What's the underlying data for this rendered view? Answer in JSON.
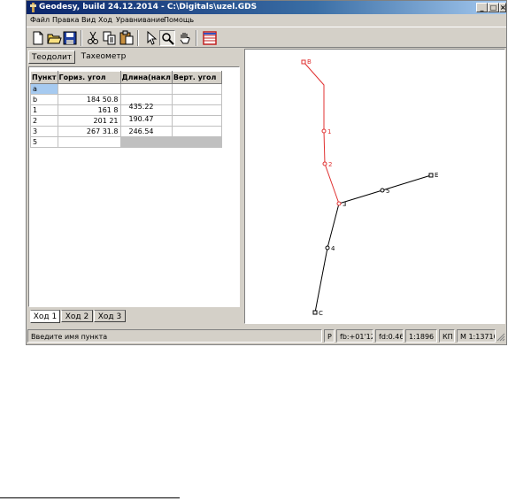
{
  "window": {
    "title": "Geodesy, build 24.12.2014 - C:\\Digitals\\uzel.GDS",
    "controls": [
      "_",
      "□",
      "×"
    ]
  },
  "menu": [
    "Файл",
    "Правка",
    "Вид",
    "Ход",
    "Уравнивание",
    "Помощь"
  ],
  "toolbar": {
    "icons": [
      "new-file-icon",
      "open-folder-icon",
      "save-icon",
      "cut-icon",
      "copy-icon",
      "paste-icon",
      "pointer-icon",
      "zoom-icon",
      "hand-icon",
      "table-icon"
    ]
  },
  "tabs": [
    "Теодолит",
    "Тахеометр"
  ],
  "grid": {
    "columns": [
      "Пункт",
      "Гориз. угол",
      "Длина(накл",
      "Верт. угол"
    ],
    "rows": [
      {
        "point": "a",
        "angle": ""
      },
      {
        "point": "b",
        "angle": "184 50.8"
      },
      {
        "point": "1",
        "angle": "161 8"
      },
      {
        "point": "2",
        "angle": "201 21"
      },
      {
        "point": "3",
        "angle": "267 31.8"
      },
      {
        "point": "5",
        "angle": ""
      }
    ],
    "distances": [
      "435.22",
      "190.47",
      "246.54"
    ]
  },
  "traverse_tabs": [
    "Ход 1",
    "Ход 2",
    "Ход 3"
  ],
  "map": {
    "points": {
      "B": "B",
      "p1": "1",
      "p2": "2",
      "p3": "3",
      "p4": "4",
      "p5": "5",
      "E": "E",
      "C": "C"
    },
    "active_color": "#e03030",
    "line_color": "#000000"
  },
  "status": {
    "message": "Введите имя пункта",
    "mode": "P",
    "fb": "fb:+01'12\"",
    "fd": "fd:0.46",
    "ratio": "1:1896",
    "kp": "КП",
    "scale": "М 1:13710"
  }
}
